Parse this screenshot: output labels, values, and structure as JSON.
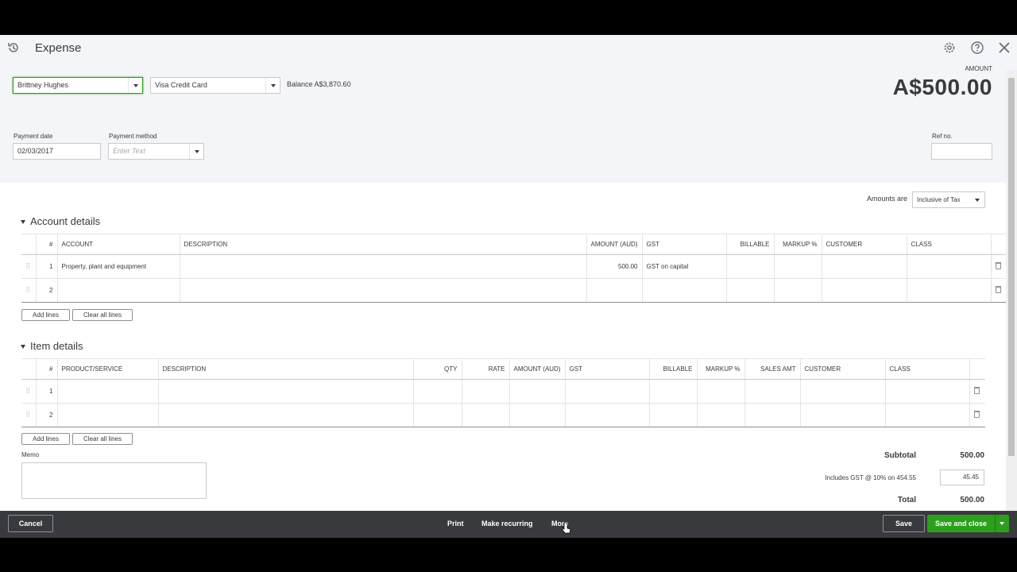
{
  "header": {
    "title": "Expense",
    "icons": [
      "history-icon",
      "gear-icon",
      "help-icon",
      "close-icon"
    ]
  },
  "payee": {
    "value": "Brittney Hughes"
  },
  "payment_account": {
    "value": "Visa Credit Card"
  },
  "balance": "Balance A$3,870.60",
  "amount": {
    "label": "AMOUNT",
    "value": "A$500.00"
  },
  "payment_date": {
    "label": "Payment date",
    "value": "02/03/2017"
  },
  "payment_method": {
    "label": "Payment method",
    "placeholder": "Enter Text"
  },
  "ref_no": {
    "label": "Ref no.",
    "value": ""
  },
  "amounts_are": {
    "label": "Amounts are",
    "value": "Inclusive of Tax"
  },
  "account_details": {
    "title": "Account details",
    "columns": [
      "#",
      "ACCOUNT",
      "DESCRIPTION",
      "AMOUNT (AUD)",
      "GST",
      "BILLABLE",
      "MARKUP %",
      "CUSTOMER",
      "CLASS"
    ],
    "rows": [
      {
        "num": "1",
        "account": "Property, plant and equipment",
        "description": "",
        "amount": "500.00",
        "gst": "GST on capital",
        "billable": "",
        "markup": "",
        "customer": "",
        "class": ""
      },
      {
        "num": "2",
        "account": "",
        "description": "",
        "amount": "",
        "gst": "",
        "billable": "",
        "markup": "",
        "customer": "",
        "class": ""
      }
    ],
    "add_lines": "Add lines",
    "clear_lines": "Clear all lines"
  },
  "item_details": {
    "title": "Item details",
    "columns": [
      "#",
      "PRODUCT/SERVICE",
      "DESCRIPTION",
      "QTY",
      "RATE",
      "AMOUNT (AUD)",
      "GST",
      "BILLABLE",
      "MARKUP %",
      "SALES AMT",
      "CUSTOMER",
      "CLASS"
    ],
    "rows": [
      {
        "num": "1"
      },
      {
        "num": "2"
      }
    ],
    "add_lines": "Add lines",
    "clear_lines": "Clear all lines"
  },
  "memo": {
    "label": "Memo",
    "value": ""
  },
  "totals": {
    "subtotal_label": "Subtotal",
    "subtotal_value": "500.00",
    "gst_label": "Includes GST @ 10% on 454.55",
    "gst_value": "45.45",
    "total_label": "Total",
    "total_value": "500.00"
  },
  "footer": {
    "cancel": "Cancel",
    "print": "Print",
    "make_recurring": "Make recurring",
    "more": "More",
    "save": "Save",
    "save_and_close": "Save and close"
  },
  "colors": {
    "accent": "#2ca01c",
    "footer_bg": "#393a3d",
    "text": "#393a3d"
  }
}
